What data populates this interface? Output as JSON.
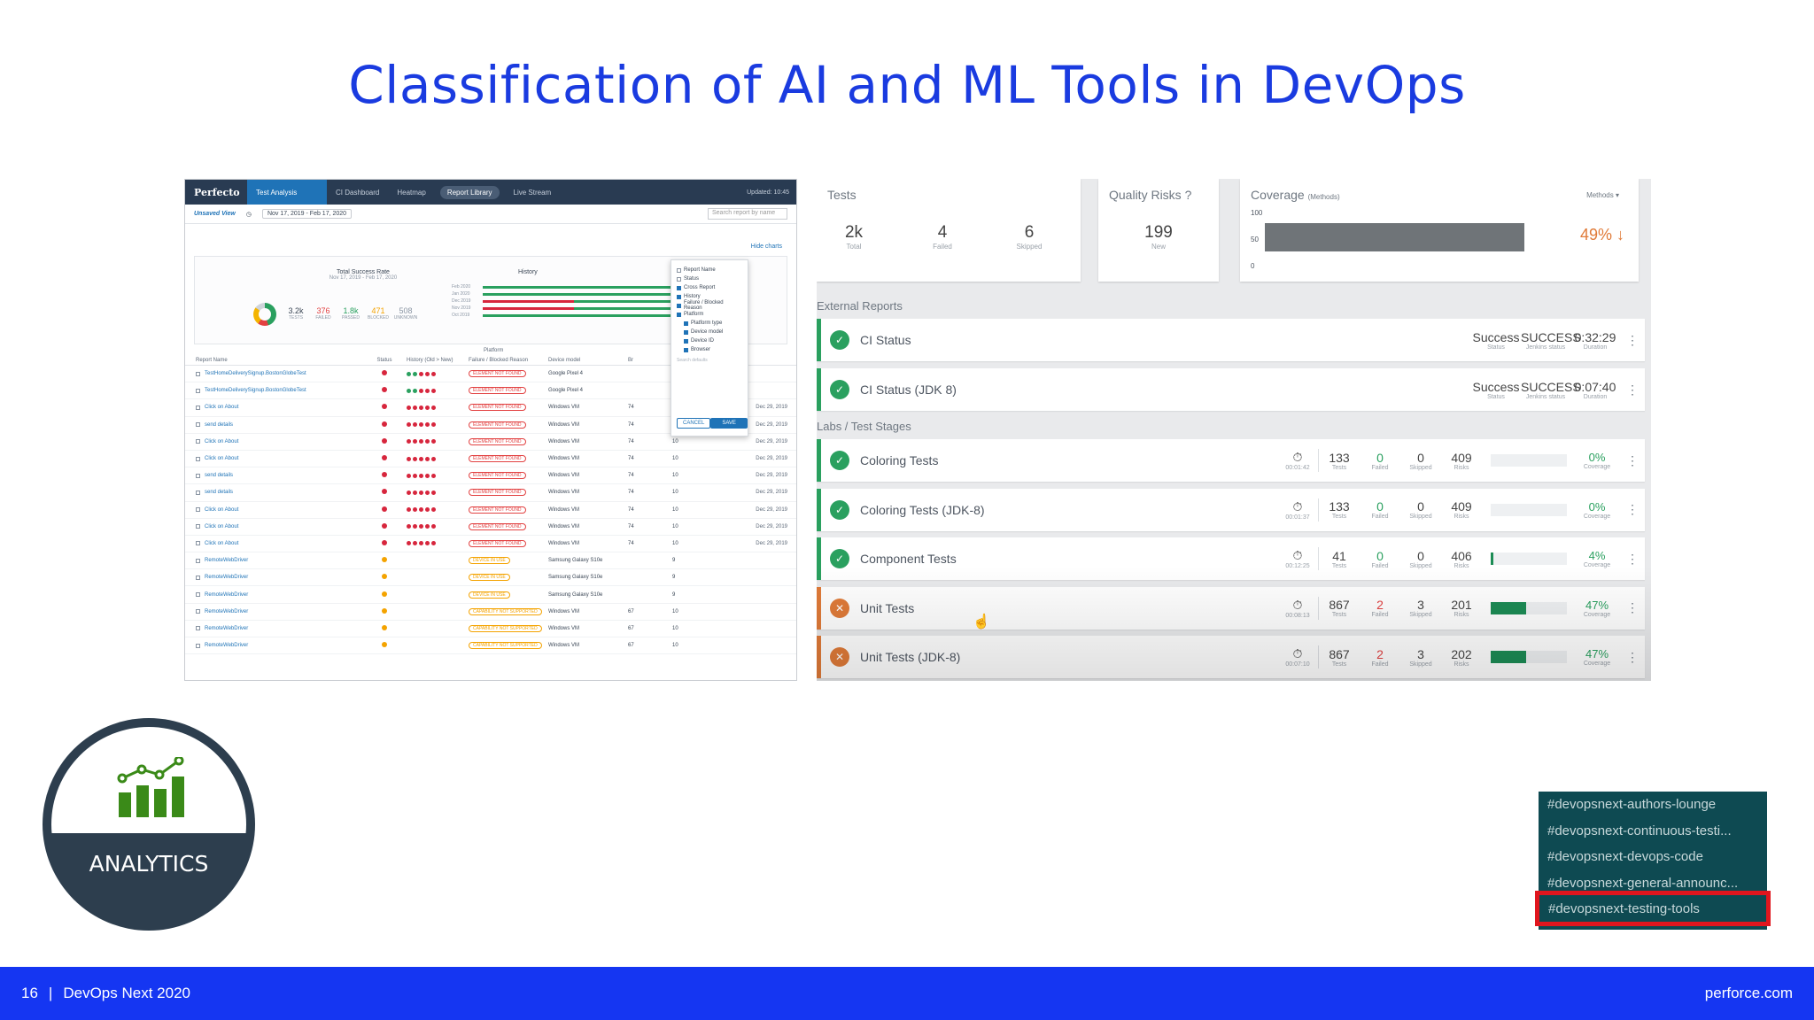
{
  "slide": {
    "title": "Classification of AI and ML Tools in DevOps"
  },
  "perfecto": {
    "logo": "Perfecto",
    "tabs": [
      "Test Analysis",
      "CI Dashboard",
      "Heatmap",
      "Report Library",
      "Live Stream"
    ],
    "updated": "Updated: 10:45",
    "unsaved_view": "Unsaved View",
    "date_range": "Nov 17, 2019 - Feb 17, 2020",
    "search_placeholder": "Search report by name",
    "hide_charts": "Hide charts",
    "total_success_rate": "Total Success Rate",
    "tsr_dates": "Nov 17, 2019 - Feb 17, 2020",
    "stats": [
      {
        "value": "3.2k",
        "label": "TESTS",
        "color": "#3a4655"
      },
      {
        "value": "376",
        "label": "FAILED",
        "color": "#e24141"
      },
      {
        "value": "1.8k",
        "label": "PASSED",
        "color": "#2aa05f"
      },
      {
        "value": "471",
        "label": "BLOCKED",
        "color": "#f4a300"
      },
      {
        "value": "508",
        "label": "UNKNOWN",
        "color": "#8a95a3"
      }
    ],
    "history_label": "History",
    "history_months": [
      "Feb 2020",
      "Jan 2020",
      "Dec 2019",
      "Nov 2019",
      "Oct 2019"
    ],
    "popup_options": [
      "Report Name",
      "Status",
      "Cross Report",
      "History",
      "Failure / Blocked Reason",
      "Platform",
      "Platform type",
      "Device model",
      "Device ID",
      "Browser"
    ],
    "popup_search": "Search defaults",
    "cancel": "CANCEL",
    "save": "SAVE",
    "platform_label": "Platform",
    "headers": [
      "Report Name",
      "Status",
      "History (Old > New)",
      "Failure / Blocked Reason",
      "Device model",
      "Br"
    ],
    "rows": [
      {
        "name": "TestHomeDeliverySignup.BostonGlobeTest",
        "status": "red",
        "reason": "ELEMENT NOT FOUND",
        "device": "Google Pixel 4",
        "os": "",
        "br": "",
        "date": ""
      },
      {
        "name": "TestHomeDeliverySignup.BostonGlobeTest",
        "status": "red",
        "reason": "ELEMENT NOT FOUND",
        "device": "Google Pixel 4",
        "os": "",
        "br": "",
        "date": ""
      },
      {
        "name": "Click on About",
        "status": "red",
        "reason": "ELEMENT NOT FOUND",
        "device": "Windows VM",
        "os": "74",
        "br": "10",
        "date": "Dec 29, 2019"
      },
      {
        "name": "send details",
        "status": "red",
        "reason": "ELEMENT NOT FOUND",
        "device": "Windows VM",
        "os": "74",
        "br": "10",
        "date": "Dec 29, 2019"
      },
      {
        "name": "Click on About",
        "status": "red",
        "reason": "ELEMENT NOT FOUND",
        "device": "Windows VM",
        "os": "74",
        "br": "10",
        "date": "Dec 29, 2019"
      },
      {
        "name": "Click on About",
        "status": "red",
        "reason": "ELEMENT NOT FOUND",
        "device": "Windows VM",
        "os": "74",
        "br": "10",
        "date": "Dec 29, 2019"
      },
      {
        "name": "send details",
        "status": "red",
        "reason": "ELEMENT NOT FOUND",
        "device": "Windows VM",
        "os": "74",
        "br": "10",
        "date": "Dec 29, 2019"
      },
      {
        "name": "send details",
        "status": "red",
        "reason": "ELEMENT NOT FOUND",
        "device": "Windows VM",
        "os": "74",
        "br": "10",
        "date": "Dec 29, 2019"
      },
      {
        "name": "Click on About",
        "status": "red",
        "reason": "ELEMENT NOT FOUND",
        "device": "Windows VM",
        "os": "74",
        "br": "10",
        "date": "Dec 29, 2019"
      },
      {
        "name": "Click on About",
        "status": "red",
        "reason": "ELEMENT NOT FOUND",
        "device": "Windows VM",
        "os": "74",
        "br": "10",
        "date": "Dec 29, 2019"
      },
      {
        "name": "Click on About",
        "status": "red",
        "reason": "ELEMENT NOT FOUND",
        "device": "Windows VM",
        "os": "74",
        "br": "10",
        "date": "Dec 29, 2019"
      },
      {
        "name": "RemoteWebDriver",
        "status": "or",
        "reason": "DEVICE IN USE",
        "device": "Samsung Galaxy S10e",
        "os": "",
        "br": "9",
        "date": ""
      },
      {
        "name": "RemoteWebDriver",
        "status": "or",
        "reason": "DEVICE IN USE",
        "device": "Samsung Galaxy S10e",
        "os": "",
        "br": "9",
        "date": ""
      },
      {
        "name": "RemoteWebDriver",
        "status": "or",
        "reason": "DEVICE IN USE",
        "device": "Samsung Galaxy S10e",
        "os": "",
        "br": "9",
        "date": ""
      },
      {
        "name": "RemoteWebDriver",
        "status": "or",
        "reason": "CAPABILITY NOT SUPPORTED",
        "device": "Windows VM",
        "os": "67",
        "br": "10",
        "date": ""
      },
      {
        "name": "RemoteWebDriver",
        "status": "or",
        "reason": "CAPABILITY NOT SUPPORTED",
        "device": "Windows VM",
        "os": "67",
        "br": "10",
        "date": ""
      },
      {
        "name": "RemoteWebDriver",
        "status": "or",
        "reason": "CAPABILITY NOT SUPPORTED",
        "device": "Windows VM",
        "os": "67",
        "br": "10",
        "date": ""
      }
    ]
  },
  "dashboard": {
    "tests": {
      "label": "Tests",
      "kpis": [
        {
          "value": "2k",
          "label": "Total"
        },
        {
          "value": "4",
          "label": "Failed"
        },
        {
          "value": "6",
          "label": "Skipped"
        }
      ]
    },
    "quality": {
      "label": "Quality Risks",
      "value": "199",
      "sub": "New"
    },
    "coverage": {
      "label": "Coverage",
      "sub": "(Methods)",
      "dropdown": "Methods",
      "pct": "49%",
      "y_top": "100",
      "y_mid": "50",
      "y_bot": "0"
    },
    "external_title": "External Reports",
    "labs_title": "Labs / Test Stages",
    "external": [
      {
        "name": "CI Status",
        "status": "Success",
        "status_label": "Status",
        "jenkins": "SUCCESS",
        "jenkins_label": "Jenkins status",
        "duration": "0:32:29",
        "duration_label": "Duration"
      },
      {
        "name": "CI Status (JDK 8)",
        "status": "Success",
        "status_label": "Status",
        "jenkins": "SUCCESS",
        "jenkins_label": "Jenkins status",
        "duration": "0:07:40",
        "duration_label": "Duration"
      }
    ],
    "labs": [
      {
        "name": "Coloring Tests",
        "time": "00:01:42",
        "tests": "133",
        "failed": "0",
        "skipped": "0",
        "risks": "409",
        "coverage": "0%",
        "fill": 0,
        "fail": false
      },
      {
        "name": "Coloring Tests (JDK-8)",
        "time": "00:01:37",
        "tests": "133",
        "failed": "0",
        "skipped": "0",
        "risks": "409",
        "coverage": "0%",
        "fill": 0,
        "fail": false
      },
      {
        "name": "Component Tests",
        "time": "00:12:25",
        "tests": "41",
        "failed": "0",
        "skipped": "0",
        "risks": "406",
        "coverage": "4%",
        "fill": 0.04,
        "fail": false
      },
      {
        "name": "Unit Tests",
        "time": "00:08:13",
        "tests": "867",
        "failed": "2",
        "skipped": "3",
        "risks": "201",
        "coverage": "47%",
        "fill": 0.47,
        "fail": true
      },
      {
        "name": "Unit Tests (JDK-8)",
        "time": "00:07:10",
        "tests": "867",
        "failed": "2",
        "skipped": "3",
        "risks": "202",
        "coverage": "47%",
        "fill": 0.47,
        "fail": true
      }
    ],
    "metric_labels": {
      "tests": "Tests",
      "failed": "Failed",
      "skipped": "Skipped",
      "risks": "Risks",
      "coverage": "Coverage"
    }
  },
  "analytics": {
    "label": "ANALYTICS"
  },
  "slack": {
    "channels": [
      "devopsnext-authors-lounge",
      "devopsnext-continuous-testi...",
      "devopsnext-devops-code",
      "devopsnext-general-announc...",
      "devopsnext-testing-tools"
    ],
    "selected_index": 4
  },
  "footer": {
    "page": "16",
    "sep": "|",
    "event": "DevOps Next 2020",
    "site": "perforce.com"
  }
}
